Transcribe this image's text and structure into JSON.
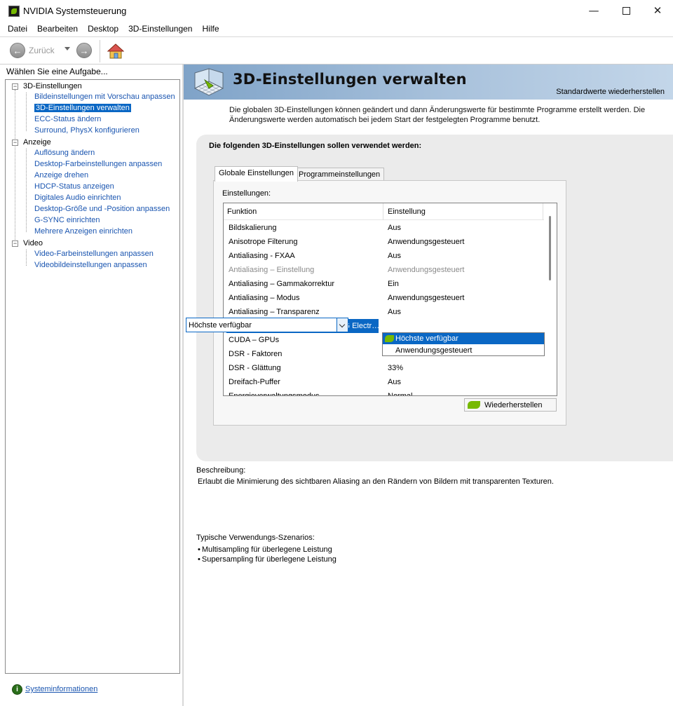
{
  "window": {
    "title": "NVIDIA Systemsteuerung"
  },
  "menu": [
    "Datei",
    "Bearbeiten",
    "Desktop",
    "3D-Einstellungen",
    "Hilfe"
  ],
  "toolbar": {
    "back_label": "Zurück"
  },
  "left": {
    "task_label": "Wählen Sie eine Aufgabe...",
    "tree": [
      {
        "label": "3D-Einstellungen",
        "children": [
          "Bildeinstellungen mit Vorschau anpassen",
          "3D-Einstellungen verwalten",
          "ECC-Status ändern",
          "Surround, PhysX konfigurieren"
        ]
      },
      {
        "label": "Anzeige",
        "children": [
          "Auflösung ändern",
          "Desktop-Farbeinstellungen anpassen",
          "Anzeige drehen",
          "HDCP-Status anzeigen",
          "Digitales Audio einrichten",
          "Desktop-Größe und -Position anpassen",
          "G-SYNC einrichten",
          "Mehrere Anzeigen einrichten"
        ]
      },
      {
        "label": "Video",
        "children": [
          "Video-Farbeinstellungen anpassen",
          "Videobildeinstellungen anpassen"
        ]
      }
    ],
    "selected": "3D-Einstellungen verwalten",
    "sysinfo_link": "Systeminformationen"
  },
  "header": {
    "title": "3D-Einstellungen verwalten",
    "restore_defaults": "Standardwerte wiederherstellen"
  },
  "intro": "Die globalen 3D-Einstellungen können geändert und dann Änderungswerte für bestimmte Programme erstellt werden. Die Änderungswerte werden automatisch bei jedem Start der festgelegten Programme benutzt.",
  "group": {
    "title": "Die folgenden 3D-Einstellungen sollen verwendet werden:",
    "tabs": [
      "Globale Einstellungen",
      "Programmeinstellungen"
    ],
    "settings_label": "Einstellungen:",
    "columns": [
      "Funktion",
      "Einstellung"
    ],
    "rows": [
      {
        "function": "Bildskalierung",
        "value": "Aus",
        "state": "normal"
      },
      {
        "function": "Anisotrope Filterung",
        "value": "Anwendungsgesteuert",
        "state": "normal"
      },
      {
        "function": "Antialiasing - FXAA",
        "value": "Aus",
        "state": "normal"
      },
      {
        "function": "Antialiasing – Einstellung",
        "value": "Anwendungsgesteuert",
        "state": "disabled"
      },
      {
        "function": "Antialiasing – Gammakorrektur",
        "value": "Ein",
        "state": "normal"
      },
      {
        "function": "Antialiasing – Modus",
        "value": "Anwendungsgesteuert",
        "state": "normal"
      },
      {
        "function": "Antialiasing – Transparenz",
        "value": "Aus",
        "state": "normal"
      },
      {
        "function": "Bevorzugte Aktualisierungsrate (LG Electr…",
        "value": "Höchste verfügbar",
        "state": "selected"
      },
      {
        "function": "CUDA – GPUs",
        "value": "",
        "state": "normal"
      },
      {
        "function": "DSR - Faktoren",
        "value": "",
        "state": "normal"
      },
      {
        "function": "DSR - Glättung",
        "value": "33%",
        "state": "normal"
      },
      {
        "function": "Dreifach-Puffer",
        "value": "Aus",
        "state": "normal"
      },
      {
        "function": "Energieverwaltungsmodus",
        "value": "Normal",
        "state": "normal"
      }
    ],
    "dropdown": {
      "value": "Höchste verfügbar",
      "options": [
        "Höchste verfügbar",
        "Anwendungsgesteuert"
      ]
    },
    "restore_button": "Wiederherstellen"
  },
  "description": {
    "label": "Beschreibung:",
    "text": "Erlaubt die Minimierung des sichtbaren Aliasing an den Rändern von Bildern mit transparenten Texturen."
  },
  "usage": {
    "label": "Typische Verwendungs-Szenarios:",
    "items": [
      "Multisampling für überlegene Leistung",
      "Supersampling für überlegene Leistung"
    ]
  }
}
